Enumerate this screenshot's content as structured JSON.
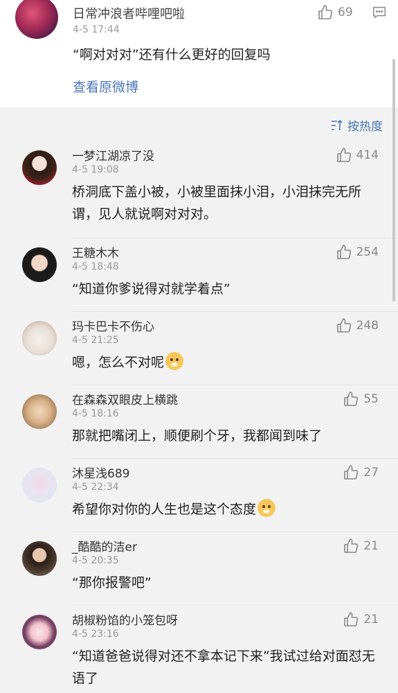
{
  "post": {
    "username": "日常冲浪者哔哩吧啦",
    "time": "4-5 17:44",
    "text": "“啊对对对”还有什么更好的回复吗",
    "view_original": "查看原微博",
    "likes": "69",
    "icons": {
      "like": "thumbs-up-icon",
      "message": "message-icon"
    }
  },
  "sort": {
    "label": "按热度",
    "icon": "sort-icon"
  },
  "comments": [
    {
      "username": "一梦江湖凉了没",
      "time": "4-5 19:08",
      "text": "桥洞底下盖小被，小被里面抹小泪，小泪抹完无所谓，见人就说啊对对对。",
      "likes": "414"
    },
    {
      "username": "王糖木木",
      "time": "4-5 18:48",
      "text": "“知道你爹说得对就学着点”",
      "likes": "254"
    },
    {
      "username": "玛卡巴卡不伤心",
      "time": "4-5 21:25",
      "text": "嗯，怎么不对呢",
      "likes": "248",
      "emoji": "doge-emoji"
    },
    {
      "username": "在森森双眼皮上横跳",
      "time": "4-5 18:16",
      "text": "那就把嘴闭上，顺便刷个牙，我都闻到味了",
      "likes": "55"
    },
    {
      "username": "沐星浅689",
      "time": "4-5 22:34",
      "text": "希望你对你的人生也是这个态度",
      "likes": "27",
      "emoji": "doge-emoji"
    },
    {
      "username": "_酷酷的洁er",
      "time": "4-5 20:35",
      "text": "“那你报警吧”",
      "likes": "21"
    },
    {
      "username": "胡椒粉馅的小笼包呀",
      "time": "4-5 23:16",
      "text": "“知道爸爸说得对还不拿本记下来”我试过给对面怼无语了",
      "likes": "21"
    }
  ]
}
